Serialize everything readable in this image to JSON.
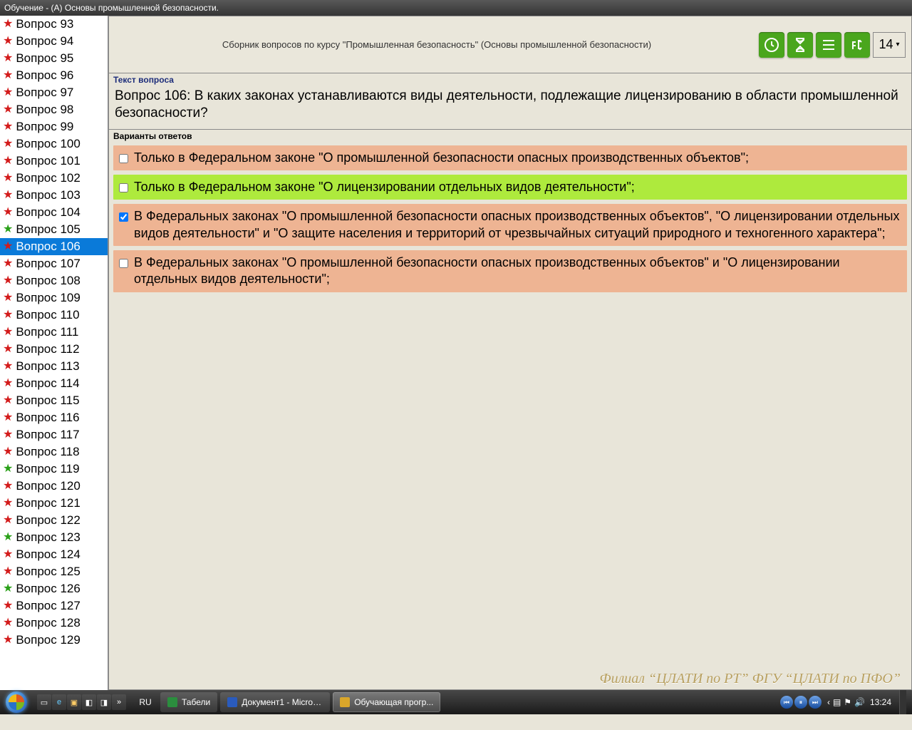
{
  "titlebar": "Обучение - (А) Основы промышленной безопасности.",
  "course_title": "Сборник вопросов по курсу \"Промышленная безопасность\" (Основы промышленной безопасности)",
  "toolbar": {
    "font_size": "14"
  },
  "labels": {
    "question_header": "Текст вопроса",
    "answers_header": "Варианты ответов"
  },
  "question_text": "Вопрос 106: В каких законах устанавливаются виды деятельности, подлежащие лицензированию в области промышленной безопасности?",
  "answers": [
    {
      "text": "Только в Федеральном законе \"О промышленной безопасности опасных производственных объектов\";",
      "status": "orange",
      "checked": false
    },
    {
      "text": "Только в Федеральном законе \"О лицензировании отдельных видов деятельности\";",
      "status": "green",
      "checked": false
    },
    {
      "text": "В Федеральных законах \"О промышленной безопасности опасных производственных объектов\", \"О лицензировании отдельных видов деятельности\" и \"О защите населения и территорий от чрезвычайных ситуаций природного и техногенного характера\";",
      "status": "orange",
      "checked": true
    },
    {
      "text": "В Федеральных законах \"О промышленной безопасности опасных производственных объектов\" и \"О лицензировании отдельных видов деятельности\";",
      "status": "orange",
      "checked": false
    }
  ],
  "sidebar": {
    "items": [
      {
        "n": 93,
        "color": "red"
      },
      {
        "n": 94,
        "color": "red"
      },
      {
        "n": 95,
        "color": "red"
      },
      {
        "n": 96,
        "color": "red"
      },
      {
        "n": 97,
        "color": "red"
      },
      {
        "n": 98,
        "color": "red"
      },
      {
        "n": 99,
        "color": "red"
      },
      {
        "n": 100,
        "color": "red"
      },
      {
        "n": 101,
        "color": "red"
      },
      {
        "n": 102,
        "color": "red"
      },
      {
        "n": 103,
        "color": "red"
      },
      {
        "n": 104,
        "color": "red"
      },
      {
        "n": 105,
        "color": "green"
      },
      {
        "n": 106,
        "color": "red",
        "selected": true
      },
      {
        "n": 107,
        "color": "red"
      },
      {
        "n": 108,
        "color": "red"
      },
      {
        "n": 109,
        "color": "red"
      },
      {
        "n": 110,
        "color": "red"
      },
      {
        "n": 111,
        "color": "red"
      },
      {
        "n": 112,
        "color": "red"
      },
      {
        "n": 113,
        "color": "red"
      },
      {
        "n": 114,
        "color": "red"
      },
      {
        "n": 115,
        "color": "red"
      },
      {
        "n": 116,
        "color": "red"
      },
      {
        "n": 117,
        "color": "red"
      },
      {
        "n": 118,
        "color": "red"
      },
      {
        "n": 119,
        "color": "green"
      },
      {
        "n": 120,
        "color": "red"
      },
      {
        "n": 121,
        "color": "red"
      },
      {
        "n": 122,
        "color": "red"
      },
      {
        "n": 123,
        "color": "green"
      },
      {
        "n": 124,
        "color": "red"
      },
      {
        "n": 125,
        "color": "red"
      },
      {
        "n": 126,
        "color": "green"
      },
      {
        "n": 127,
        "color": "red"
      },
      {
        "n": 128,
        "color": "red"
      },
      {
        "n": 129,
        "color": "red"
      }
    ],
    "label_prefix": "Вопрос"
  },
  "watermark": "Филиал “ЦЛАТИ по РТ” ФГУ “ЦЛАТИ по ПФО”",
  "taskbar": {
    "lang": "RU",
    "tasks": [
      {
        "label": "Табели",
        "active": false,
        "icon": "excel"
      },
      {
        "label": "Документ1 - Micros...",
        "active": false,
        "icon": "word"
      },
      {
        "label": "Обучающая прогр...",
        "active": true,
        "icon": "app"
      }
    ],
    "clock": "13:24"
  }
}
